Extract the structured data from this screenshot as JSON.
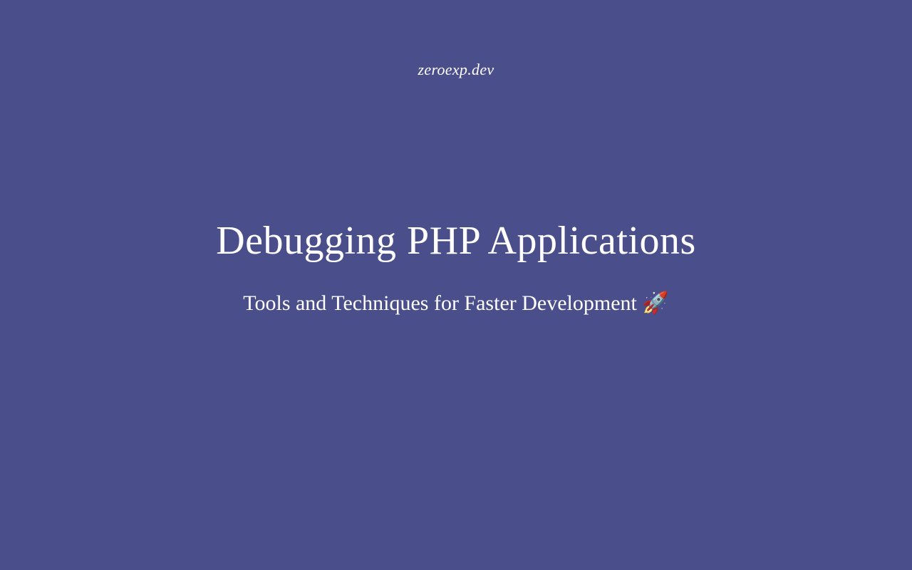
{
  "site_name": "zeroexp.dev",
  "title": "Debugging PHP Applications",
  "subtitle": "Tools and Techniques for Faster Development 🚀"
}
